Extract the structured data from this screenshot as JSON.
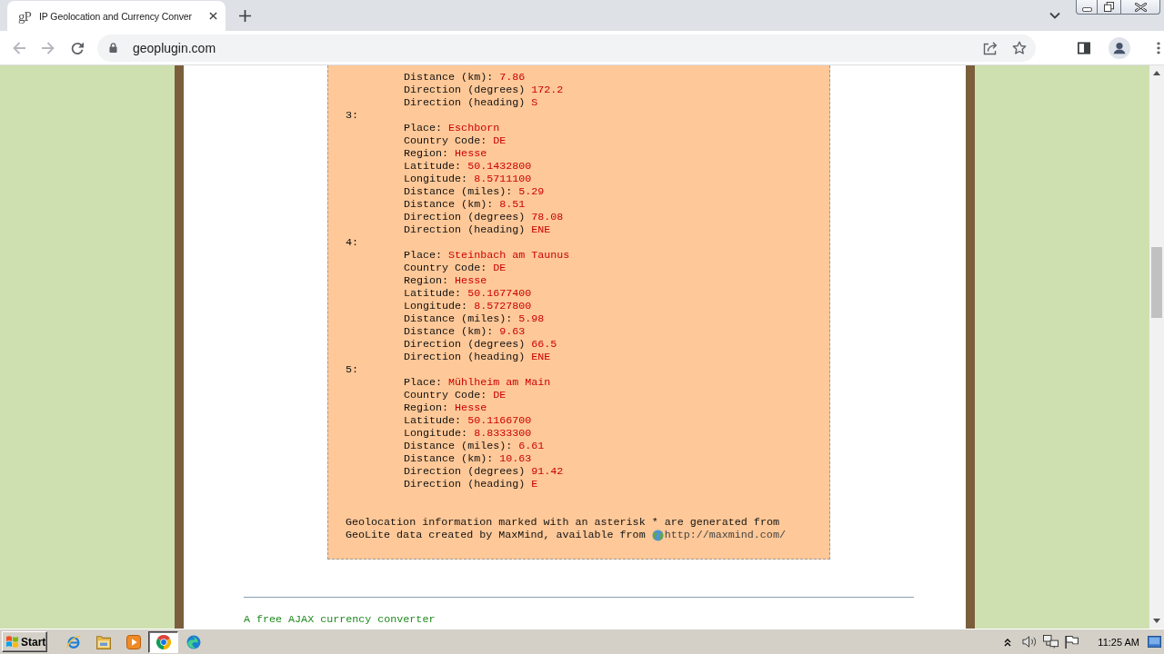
{
  "browser": {
    "tab": {
      "favicon": "gP",
      "title": "IP Geolocation and Currency Conver",
      "selected": true
    },
    "nav_buttons": [
      {
        "kind": "back",
        "disabled": true
      },
      {
        "kind": "forward",
        "disabled": true
      },
      {
        "kind": "reload",
        "disabled": false
      }
    ],
    "address": "geoplugin.com"
  },
  "page": {
    "entries": [
      {
        "fields": [
          {
            "name": "Distance (km):",
            "value": "7.86"
          },
          {
            "name": "Direction (degrees)",
            "value": "172.2"
          },
          {
            "name": "Direction (heading)",
            "value": "S"
          }
        ]
      },
      {
        "label": "3:",
        "fields": [
          {
            "name": "Place:",
            "value": "Eschborn"
          },
          {
            "name": "Country Code:",
            "value": "DE"
          },
          {
            "name": "Region:",
            "value": "Hesse"
          },
          {
            "name": "Latitude:",
            "value": "50.1432800"
          },
          {
            "name": "Longitude:",
            "value": "8.5711100"
          },
          {
            "name": "Distance (miles):",
            "value": "5.29"
          },
          {
            "name": "Distance (km):",
            "value": "8.51"
          },
          {
            "name": "Direction (degrees)",
            "value": "78.08"
          },
          {
            "name": "Direction (heading)",
            "value": "ENE"
          }
        ]
      },
      {
        "label": "4:",
        "fields": [
          {
            "name": "Place:",
            "value": "Steinbach am Taunus"
          },
          {
            "name": "Country Code:",
            "value": "DE"
          },
          {
            "name": "Region:",
            "value": "Hesse"
          },
          {
            "name": "Latitude:",
            "value": "50.1677400"
          },
          {
            "name": "Longitude:",
            "value": "8.5727800"
          },
          {
            "name": "Distance (miles):",
            "value": "5.98"
          },
          {
            "name": "Distance (km):",
            "value": "9.63"
          },
          {
            "name": "Direction (degrees)",
            "value": "66.5"
          },
          {
            "name": "Direction (heading)",
            "value": "ENE"
          }
        ]
      },
      {
        "label": "5:",
        "fields": [
          {
            "name": "Place:",
            "value": "Mühlheim am Main"
          },
          {
            "name": "Country Code:",
            "value": "DE"
          },
          {
            "name": "Region:",
            "value": "Hesse"
          },
          {
            "name": "Latitude:",
            "value": "50.1166700"
          },
          {
            "name": "Longitude:",
            "value": "8.8333300"
          },
          {
            "name": "Distance (miles):",
            "value": "6.61"
          },
          {
            "name": "Distance (km):",
            "value": "10.63"
          },
          {
            "name": "Direction (degrees)",
            "value": "91.42"
          },
          {
            "name": "Direction (heading)",
            "value": "E"
          }
        ]
      }
    ],
    "note": {
      "text": "Geolocation information marked with an asterisk * are generated from GeoLite data created by MaxMind, available from",
      "link": "http://maxmind.com/"
    },
    "heading": "A free AJAX currency converter"
  },
  "taskbar": {
    "start": "Start",
    "apps": [
      {
        "kind": "ie",
        "selected": false
      },
      {
        "kind": "folder",
        "selected": false
      },
      {
        "kind": "media",
        "selected": false
      },
      {
        "kind": "chrome",
        "selected": true
      },
      {
        "kind": "edge",
        "selected": false
      }
    ],
    "clock": "11:25 AM"
  }
}
